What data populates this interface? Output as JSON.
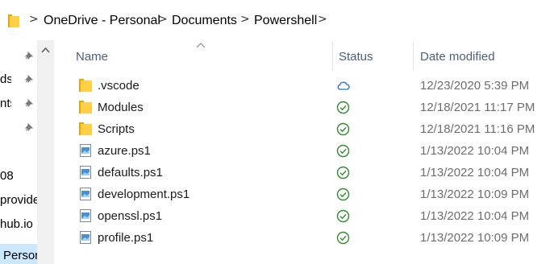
{
  "address_bar": {
    "breadcrumbs": [
      "OneDrive - Personal",
      "Documents",
      "Powershell"
    ],
    "separator": ">"
  },
  "nav_pane": {
    "items": [
      {
        "label": "ds",
        "pinned": true
      },
      {
        "label": "nts",
        "pinned": true
      },
      {
        "label": "",
        "pinned": true
      },
      {
        "label": "",
        "pinned": true
      },
      {
        "label": "08",
        "pinned": false
      },
      {
        "label": "provide",
        "pinned": false
      },
      {
        "label": "hub.io",
        "pinned": false
      },
      {
        "label": "Person",
        "pinned": false,
        "selected": true
      }
    ]
  },
  "columns": {
    "name": "Name",
    "status": "Status",
    "date_modified": "Date modified"
  },
  "files": [
    {
      "name": ".vscode",
      "type": "folder",
      "status": "cloud",
      "date": "12/23/2020 5:39 PM"
    },
    {
      "name": "Modules",
      "type": "folder",
      "status": "synced",
      "date": "12/18/2021 11:17 PM"
    },
    {
      "name": "Scripts",
      "type": "folder",
      "status": "synced",
      "date": "12/18/2021 11:16 PM"
    },
    {
      "name": "azure.ps1",
      "type": "ps1",
      "status": "synced",
      "date": "1/13/2022 10:04 PM"
    },
    {
      "name": "defaults.ps1",
      "type": "ps1",
      "status": "synced",
      "date": "1/13/2022 10:04 PM"
    },
    {
      "name": "development.ps1",
      "type": "ps1",
      "status": "synced",
      "date": "1/13/2022 10:09 PM"
    },
    {
      "name": "openssl.ps1",
      "type": "ps1",
      "status": "synced",
      "date": "1/13/2022 10:04 PM"
    },
    {
      "name": "profile.ps1",
      "type": "ps1",
      "status": "synced",
      "date": "1/13/2022 10:09 PM"
    }
  ],
  "colors": {
    "folder": "#ffcf48",
    "synced": "#2e8b2e",
    "cloud": "#1a73c8",
    "header_text": "#4c607a",
    "selected_bg": "#cce8ff"
  }
}
